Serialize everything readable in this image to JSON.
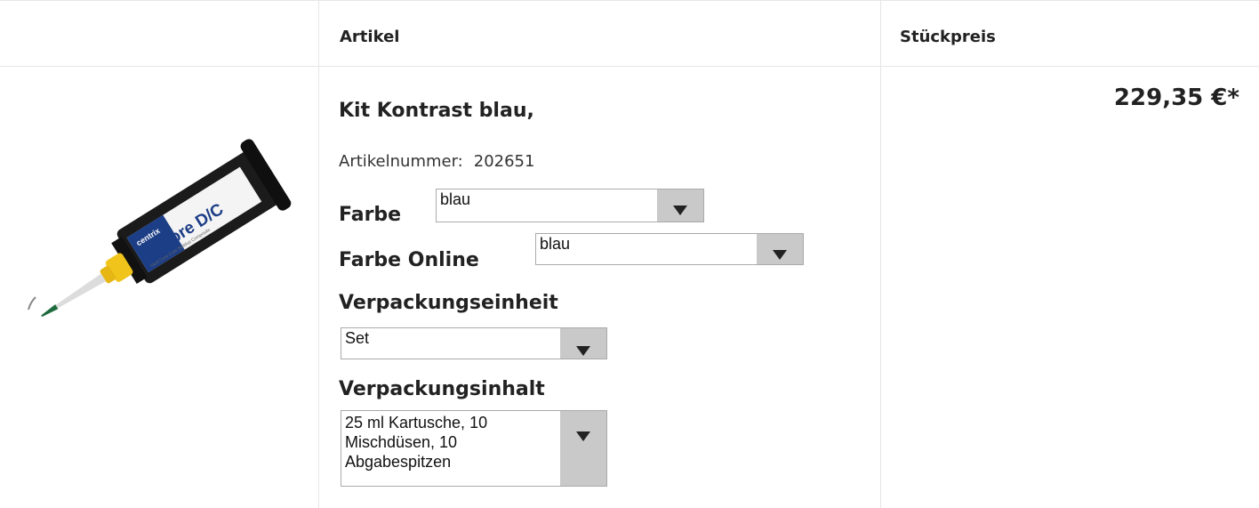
{
  "table": {
    "header": {
      "artikel": "Artikel",
      "stueckpreis": "Stückpreis"
    }
  },
  "product": {
    "title": "Kit Kontrast blau,",
    "artikelnummer_label": "Artikelnummer:",
    "artikelnummer": "202651",
    "price": "229,35 €*",
    "image_brand": "Encore D/C",
    "image_maker": "centrix",
    "image_caption": "Dual Cure Core Buildup Composite"
  },
  "options": {
    "farbe": {
      "label": "Farbe",
      "value": "blau"
    },
    "farbe_online": {
      "label": "Farbe Online",
      "value": "blau"
    },
    "verpackungseinheit": {
      "label": "Verpackungseinheit",
      "value": "Set"
    },
    "verpackungsinhalt": {
      "label": "Verpackungsinhalt",
      "value_lines": [
        "25 ml Kartusche, 10",
        "Mischdüsen, 10",
        "Abgabespitzen"
      ]
    }
  }
}
